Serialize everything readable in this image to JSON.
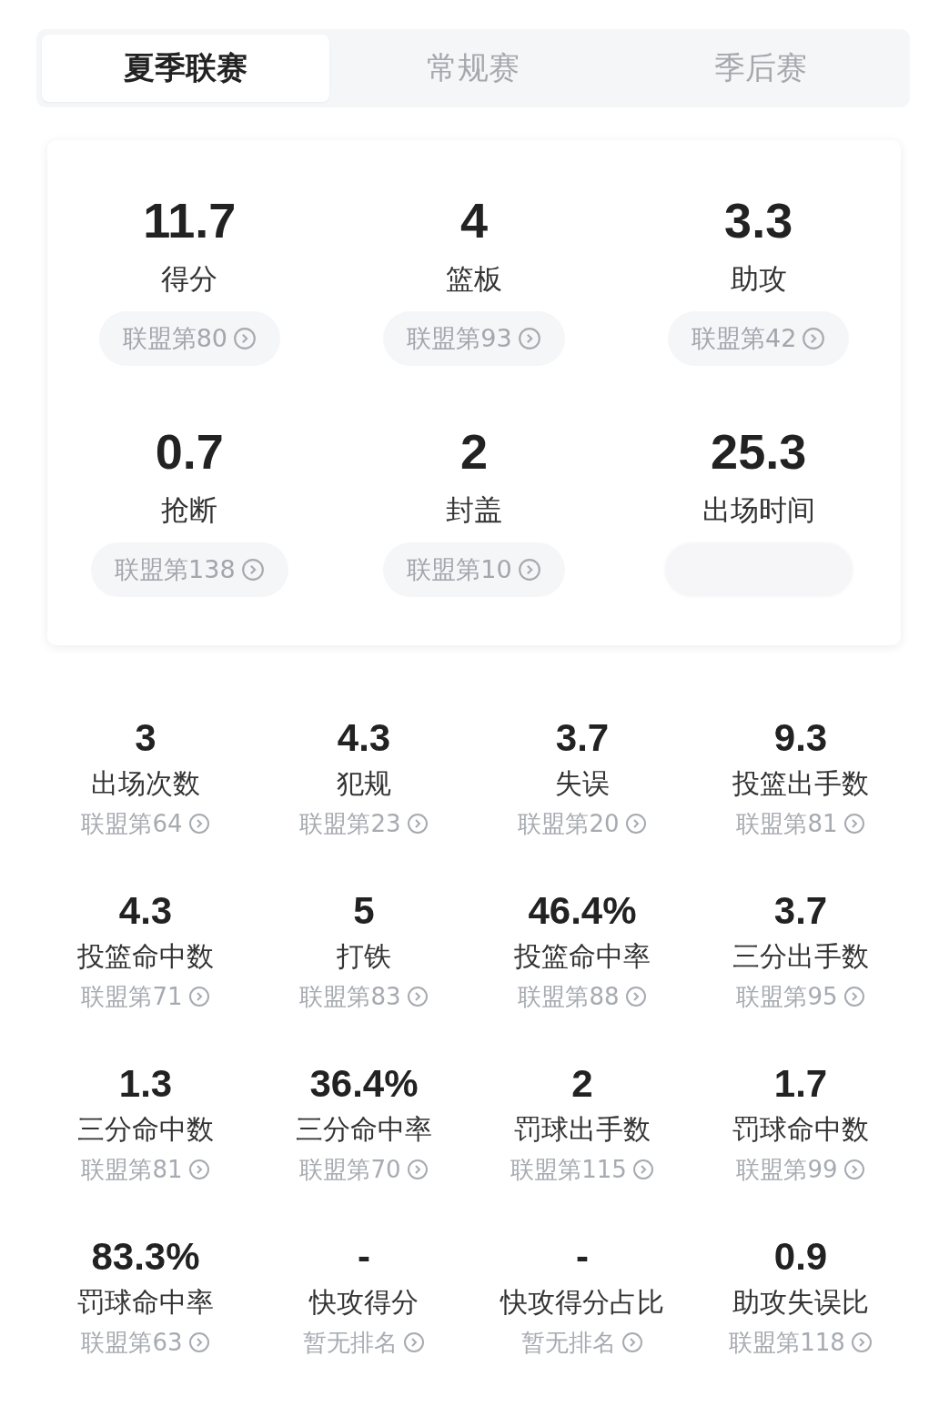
{
  "tabs": [
    {
      "label": "夏季联赛",
      "selected": true
    },
    {
      "label": "常规赛",
      "selected": false
    },
    {
      "label": "季后赛",
      "selected": false
    }
  ],
  "main_stats": [
    {
      "value": "11.7",
      "label": "得分",
      "rank": "联盟第80"
    },
    {
      "value": "4",
      "label": "篮板",
      "rank": "联盟第93"
    },
    {
      "value": "3.3",
      "label": "助攻",
      "rank": "联盟第42"
    },
    {
      "value": "0.7",
      "label": "抢断",
      "rank": "联盟第138"
    },
    {
      "value": "2",
      "label": "封盖",
      "rank": "联盟第10"
    },
    {
      "value": "25.3",
      "label": "出场时间"
    }
  ],
  "detail_stats": [
    {
      "value": "3",
      "label": "出场次数",
      "rank": "联盟第64"
    },
    {
      "value": "4.3",
      "label": "犯规",
      "rank": "联盟第23"
    },
    {
      "value": "3.7",
      "label": "失误",
      "rank": "联盟第20"
    },
    {
      "value": "9.3",
      "label": "投篮出手数",
      "rank": "联盟第81"
    },
    {
      "value": "4.3",
      "label": "投篮命中数",
      "rank": "联盟第71"
    },
    {
      "value": "5",
      "label": "打铁",
      "rank": "联盟第83"
    },
    {
      "value": "46.4%",
      "label": "投篮命中率",
      "rank": "联盟第88"
    },
    {
      "value": "3.7",
      "label": "三分出手数",
      "rank": "联盟第95"
    },
    {
      "value": "1.3",
      "label": "三分命中数",
      "rank": "联盟第81"
    },
    {
      "value": "36.4%",
      "label": "三分命中率",
      "rank": "联盟第70"
    },
    {
      "value": "2",
      "label": "罚球出手数",
      "rank": "联盟第115"
    },
    {
      "value": "1.7",
      "label": "罚球命中数",
      "rank": "联盟第99"
    },
    {
      "value": "83.3%",
      "label": "罚球命中率",
      "rank": "联盟第63"
    },
    {
      "value": "-",
      "label": "快攻得分",
      "rank": "暂无排名"
    },
    {
      "value": "-",
      "label": "快攻得分占比",
      "rank": "暂无排名"
    },
    {
      "value": "0.9",
      "label": "助攻失误比",
      "rank": "联盟第118"
    }
  ]
}
